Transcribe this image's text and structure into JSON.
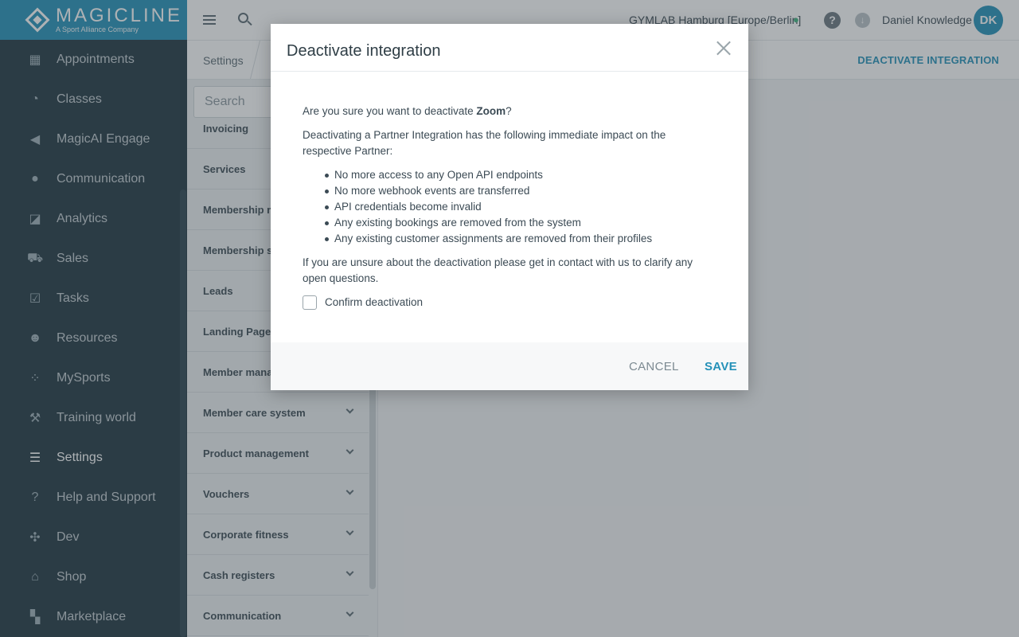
{
  "brand": {
    "name": "MAGICLINE",
    "tagline": "A Sport Alliance Company",
    "color": "#2491b8"
  },
  "sidebar": {
    "items": [
      {
        "label": "Appointments",
        "icon": "calendar-icon",
        "glyph": "▦"
      },
      {
        "label": "Classes",
        "icon": "stopwatch-icon",
        "glyph": "◔"
      },
      {
        "label": "MagicAI Engage",
        "icon": "megaphone-icon",
        "glyph": "◀"
      },
      {
        "label": "Communication",
        "icon": "chat-icon",
        "glyph": "●"
      },
      {
        "label": "Analytics",
        "icon": "chart-icon",
        "glyph": "◪"
      },
      {
        "label": "Sales",
        "icon": "cart-icon",
        "glyph": "⛟"
      },
      {
        "label": "Tasks",
        "icon": "checkbox-icon",
        "glyph": "☑"
      },
      {
        "label": "Resources",
        "icon": "people-icon",
        "glyph": "☻"
      },
      {
        "label": "MySports",
        "icon": "dots-grid-icon",
        "glyph": "⁘"
      },
      {
        "label": "Training world",
        "icon": "dumbbell-icon",
        "glyph": "⚒"
      },
      {
        "label": "Settings",
        "icon": "sliders-icon",
        "glyph": "☰"
      },
      {
        "label": "Help and Support",
        "icon": "help-chat-icon",
        "glyph": "?"
      },
      {
        "label": "Dev",
        "icon": "crosshair-icon",
        "glyph": "✣"
      },
      {
        "label": "Shop",
        "icon": "store-icon",
        "glyph": "⌂"
      },
      {
        "label": "Marketplace",
        "icon": "apps-grid-icon",
        "glyph": "▚"
      }
    ],
    "active_index": 10
  },
  "topbar": {
    "studio": "GYMLAB Hamburg [Europe/Berlin]",
    "user_name": "Daniel Knowledge",
    "user_initials": "DK",
    "help_glyph": "?",
    "download_glyph": "↓"
  },
  "subheader": {
    "breadcrumb": "Settings",
    "action": "DEACTIVATE INTEGRATION"
  },
  "settings": {
    "search_placeholder": "Search",
    "items": [
      {
        "label": "Invoicing",
        "has_chevron": false
      },
      {
        "label": "Services",
        "has_chevron": false
      },
      {
        "label": "Membership m",
        "has_chevron": false
      },
      {
        "label": "Membership sa",
        "has_chevron": false
      },
      {
        "label": "Leads",
        "has_chevron": false
      },
      {
        "label": "Landing Pages",
        "has_chevron": false
      },
      {
        "label": "Member mana",
        "has_chevron": false
      },
      {
        "label": "Member care system",
        "has_chevron": true
      },
      {
        "label": "Product management",
        "has_chevron": true
      },
      {
        "label": "Vouchers",
        "has_chevron": true
      },
      {
        "label": "Corporate fitness",
        "has_chevron": true
      },
      {
        "label": "Cash registers",
        "has_chevron": true
      },
      {
        "label": "Communication",
        "has_chevron": true
      }
    ]
  },
  "modal": {
    "title": "Deactivate integration",
    "question_prefix": "Are you sure you want to deactivate ",
    "integration_name": "Zoom",
    "question_suffix": "?",
    "impact_intro": "Deactivating a Partner Integration has the following immediate impact on the respective Partner:",
    "impacts": [
      "No more access to any Open API endpoints",
      "No more webhook events are transferred",
      "API credentials become invalid",
      "Any existing bookings are removed from the system",
      "Any existing customer assignments are removed from their profiles"
    ],
    "unsure_text": "If you are unsure about the deactivation please get in contact with us to clarify any open questions.",
    "confirm_label": "Confirm deactivation",
    "confirm_checked": false,
    "cancel_label": "CANCEL",
    "save_label": "SAVE"
  }
}
